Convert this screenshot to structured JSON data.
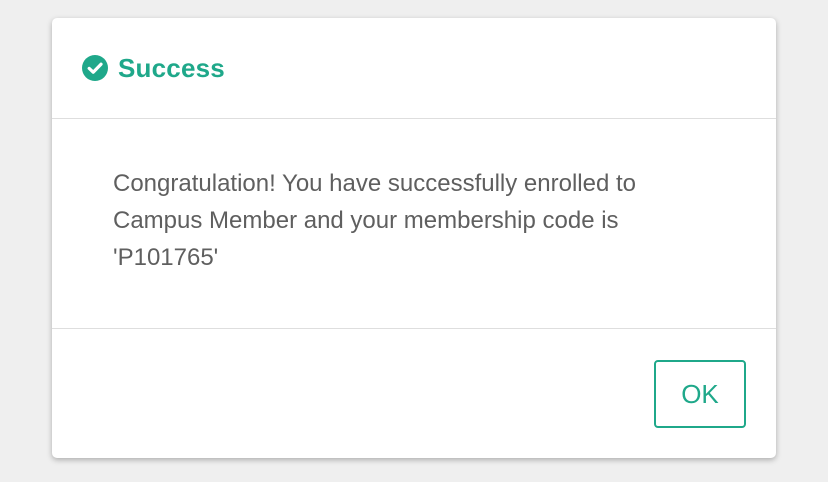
{
  "dialog": {
    "title": "Success",
    "icon": "check-circle-icon",
    "message": "Congratulation! You have successfully enrolled to Campus Member and your membership code is 'P101765'",
    "ok_label": "OK"
  },
  "colors": {
    "accent": "#1fa88a",
    "text": "#5f5f5f",
    "background": "#efefef",
    "divider": "#dedede"
  }
}
